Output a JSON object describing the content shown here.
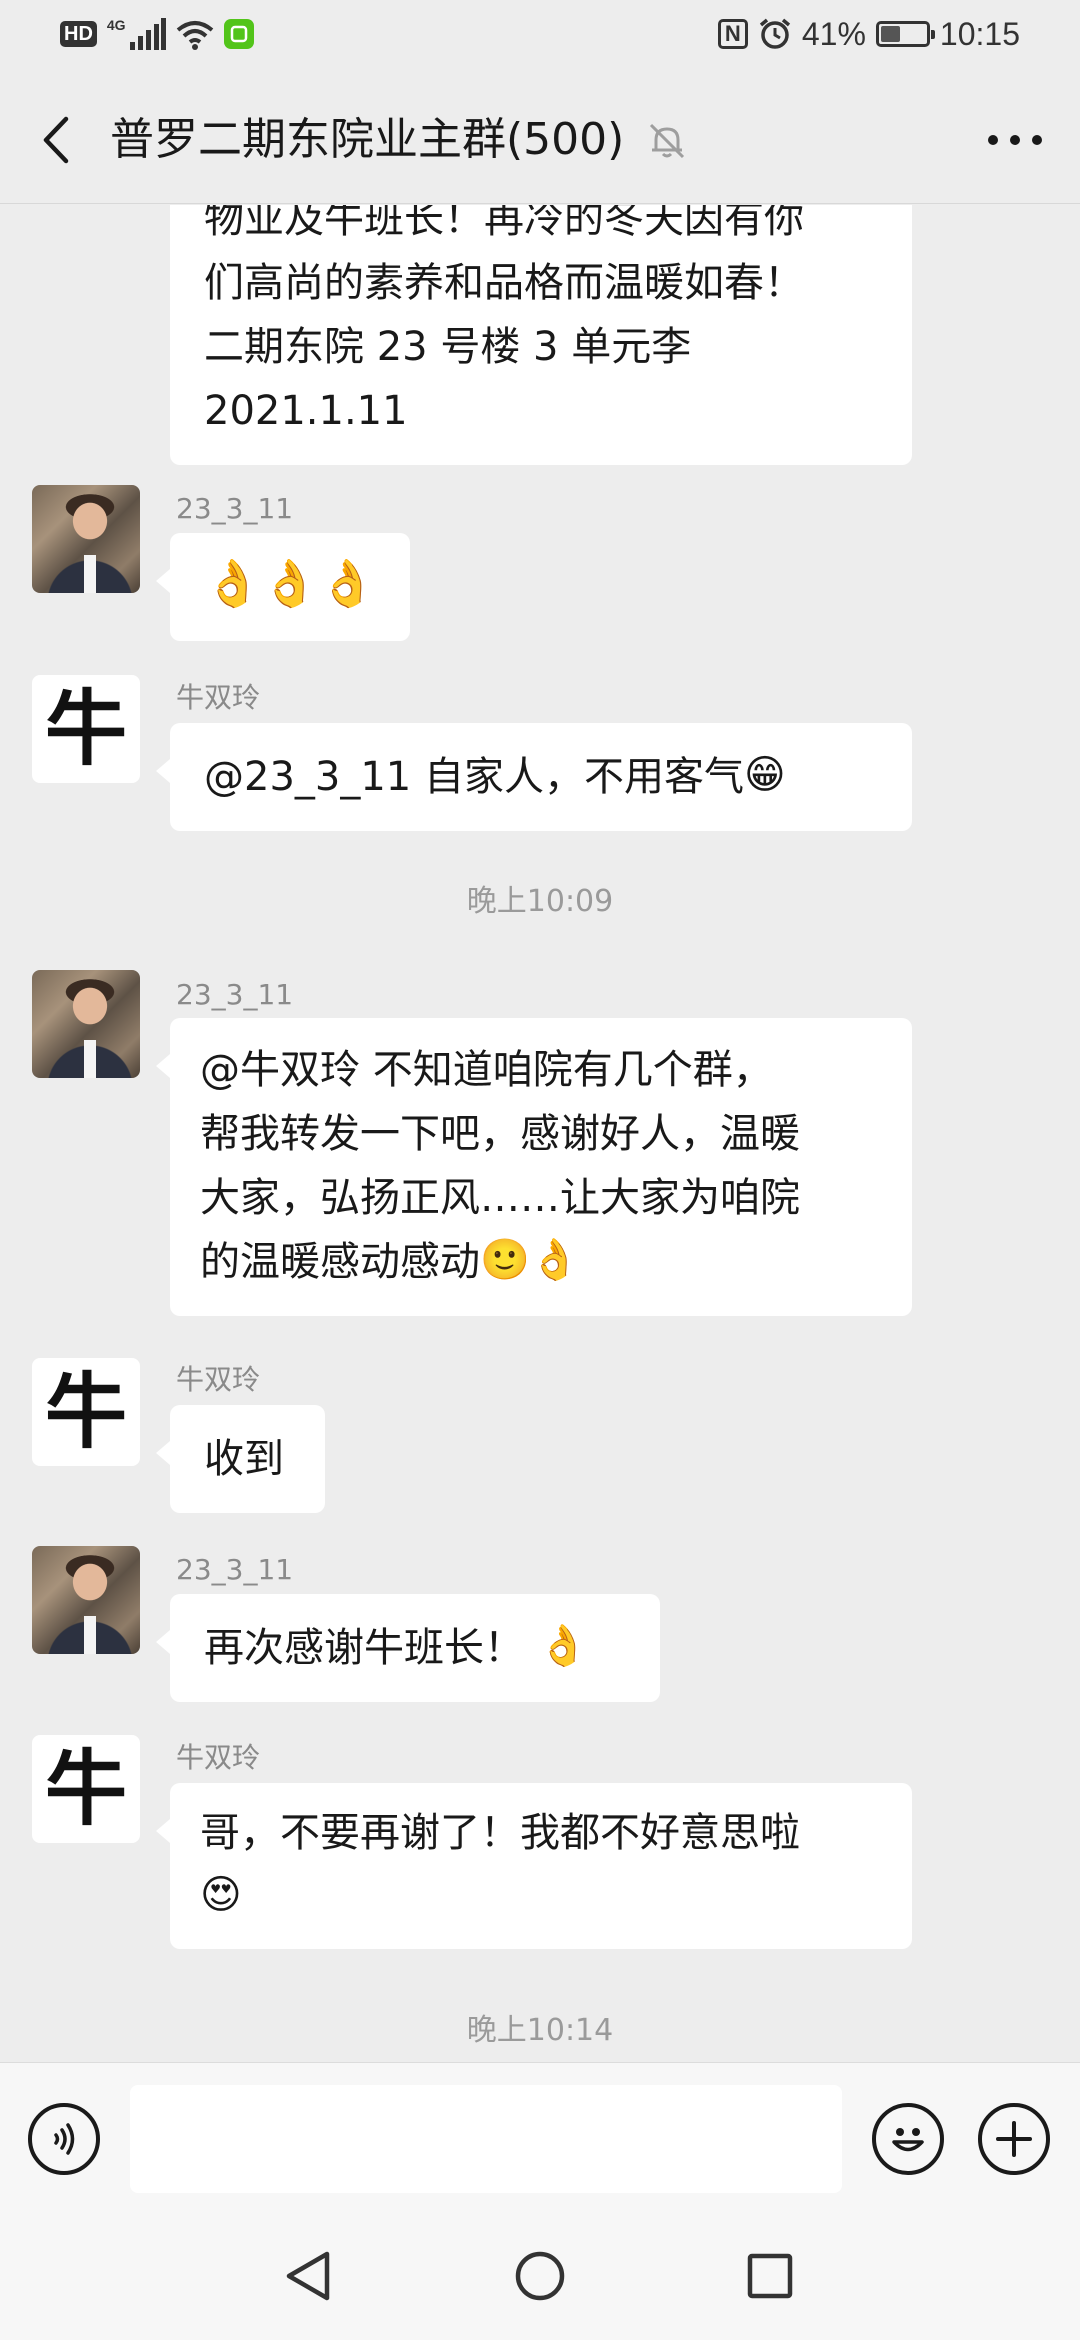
{
  "status_bar": {
    "hd": "HD",
    "network": "4G",
    "battery_percent": "41%",
    "battery_level": 0.41,
    "time": "10:15",
    "icons": [
      "signal-icon",
      "wifi-icon",
      "wechat-notification-icon",
      "nfc-icon",
      "alarm-icon",
      "battery-icon"
    ]
  },
  "header": {
    "title": "普罗二期东院业主群(500)",
    "back_icon": "chevron-left-icon",
    "mute_icon": "bell-off-icon",
    "more_icon": "more-horizontal-icon"
  },
  "messages": {
    "m0": {
      "lines": [
        "物业及牛班长！再冷的冬天因有你",
        "们高尚的素养和品格而温暖如春！",
        "二期东院 23 号楼 3 单元李",
        "2021.1.11"
      ]
    },
    "m1": {
      "sender": "23_3_11",
      "emoji": "👌👌👌"
    },
    "m2": {
      "sender": "牛双玲",
      "text": "@23_3_11  自家人，不用客气",
      "emoji": "😁"
    },
    "t1": "晚上10:09",
    "m3": {
      "sender": "23_3_11",
      "lines": [
        "@牛双玲  不知道咱院有几个群，",
        "帮我转发一下吧，感谢好人，温暖",
        "大家，弘扬正风……让大家为咱院",
        "的温暖感动感动"
      ],
      "emoji": "🙂👌"
    },
    "m4": {
      "sender": "牛双玲",
      "text": "收到"
    },
    "m5": {
      "sender": "23_3_11",
      "text": "再次感谢牛班长！",
      "emoji": "👌"
    },
    "m6": {
      "sender": "牛双玲",
      "text": "哥，不要再谢了！我都不好意思啦",
      "emoji": "😍"
    },
    "t2": "晚上10:14"
  },
  "avatars": {
    "niu_char": "牛"
  },
  "input_bar": {
    "voice_icon": "voice-icon",
    "emoji_icon": "emoji-icon",
    "plus_icon": "plus-circle-icon",
    "value": ""
  },
  "nav_bar": {
    "icons": [
      "back-triangle-icon",
      "home-circle-icon",
      "recents-square-icon"
    ]
  }
}
